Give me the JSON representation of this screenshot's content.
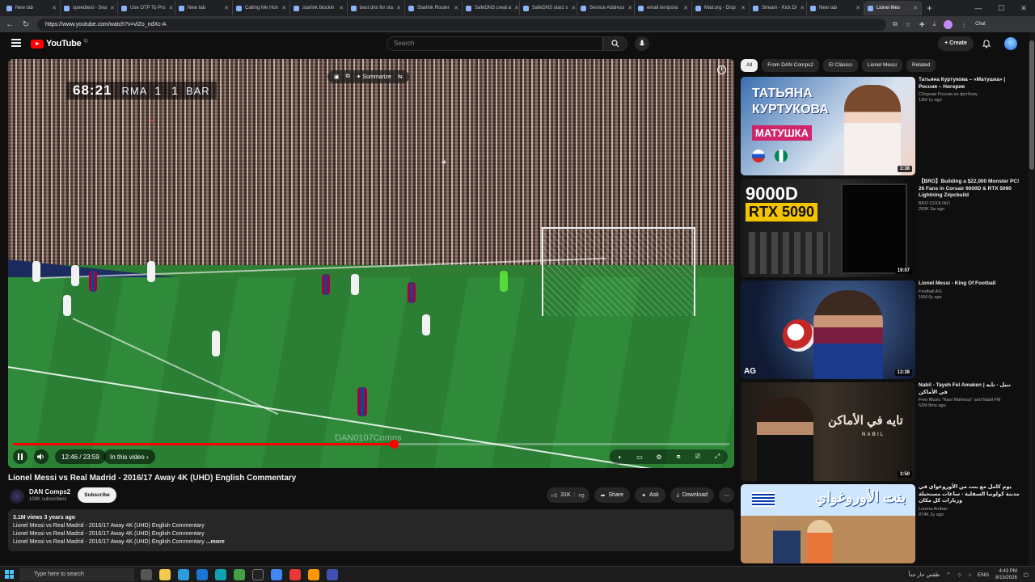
{
  "browser": {
    "tabs": [
      {
        "label": "New tab",
        "active": false
      },
      {
        "label": "speedtest - Sea",
        "active": false
      },
      {
        "label": "Use OTP To Pro",
        "active": false
      },
      {
        "label": "New tab",
        "active": false
      },
      {
        "label": "Calling Me Hon",
        "active": false
      },
      {
        "label": "starlink blockin",
        "active": false
      },
      {
        "label": "best dns for sta",
        "active": false
      },
      {
        "label": "Starlink Router",
        "active": false
      },
      {
        "label": "SafeDNS creat a",
        "active": false
      },
      {
        "label": "SafeDNS starz s",
        "active": false
      },
      {
        "label": "Service Address",
        "active": false
      },
      {
        "label": "email tempora",
        "active": false
      },
      {
        "label": "Mail.org - Disp",
        "active": false
      },
      {
        "label": "Stream - Kick Di",
        "active": false
      },
      {
        "label": "New tab",
        "active": false
      },
      {
        "label": "Lionel Mes",
        "active": true
      }
    ],
    "url": "https://www.youtube.com/watch?v=vlZo_ndXc-A",
    "chat_label": "Chat"
  },
  "header": {
    "logo_text": "YouTube",
    "logo_region": "IQ",
    "search_placeholder": "Search",
    "create_label": "+ Create"
  },
  "player": {
    "scorebug": {
      "time": "68:21",
      "home": "RMA",
      "home_score": "1",
      "away_score": "1",
      "away": "BAR"
    },
    "overlay_label": "Summarize",
    "watermark": "DAN0107Comps",
    "time_display": "12:46 / 23:59",
    "in_this_video": "In this video",
    "progress": 0.532
  },
  "video": {
    "title": "Lionel Messi vs Real Madrid - 2016/17 Away 4K (UHD) English Commentary",
    "channel": "DAN Comps2",
    "subscribers": "100K subscribers",
    "subscribe_label": "Subscribe",
    "likes": "31K",
    "share_label": "Share",
    "ask_label": "Ask",
    "download_label": "Download",
    "description": {
      "meta": "3.1M views  3 years ago",
      "lines": [
        "Lionel Messi vs Real Madrid - 2016/17 Away 4K (UHD) English Commentary",
        "Lionel Messi vs Real Madrid - 2016/17 Away 4K (UHD) English Commentary",
        "Lionel Messi vs Real Madrid - 2016/17 Away 4K (UHD) English Commentary"
      ],
      "more": "...more"
    }
  },
  "sidebar": {
    "chips": [
      "All",
      "From DAN Comps2",
      "El Clásico",
      "Lionel Messi",
      "Related"
    ],
    "recs": [
      {
        "title": "Татьяна Куртукова – «Матушка» | Россия – Нигерия",
        "channel": "Сборная России по футболу",
        "meta": "13M  1y ago",
        "duration": "3:38",
        "thumb_text": [
          "ТАТЬЯНА",
          "КУРТУКОВА",
          "МАТУШКА"
        ]
      },
      {
        "title": "【BRO】Building a $22,000 Monster PC! 26 Fans in Corsair 9000D & RTX 5090 Lightning Z#pcbuild",
        "channel": "BRO COOLINO",
        "meta": "253K  2w ago",
        "duration": "19:07",
        "thumb_text": [
          "9000D",
          "RTX 5090"
        ]
      },
      {
        "title": "Lionel Messi - King Of Football",
        "channel": "Football AG",
        "meta": "16M  6y ago",
        "duration": "13:38",
        "thumb_text": [
          "AG"
        ]
      },
      {
        "title": "Nabil - Tayeh Fel Amaken | نبيل - تايه في الأماكن",
        "channel": "Free Music \"Nasr Mahrous\" and Nabil FM",
        "meta": "52M  8mo ago",
        "duration": "3:50",
        "thumb_text": [
          "تايه في الأماكن",
          "NABIL"
        ]
      },
      {
        "title": "يوم كامل مع بنت من الأوروغواي في مدينة كولونيا السفلية - ساعات مستحيلة وزيارات كل مكان",
        "channel": "Lorena Arriban",
        "meta": "874K  2y ago",
        "duration": "",
        "thumb_text": [
          "بنت الأوروغواي"
        ]
      }
    ]
  },
  "taskbar": {
    "search_placeholder": "Type here to search",
    "weather_text": "طقس حار جداً",
    "lang": "ENG",
    "time": "4:43 PM",
    "date": "8/15/2026"
  }
}
